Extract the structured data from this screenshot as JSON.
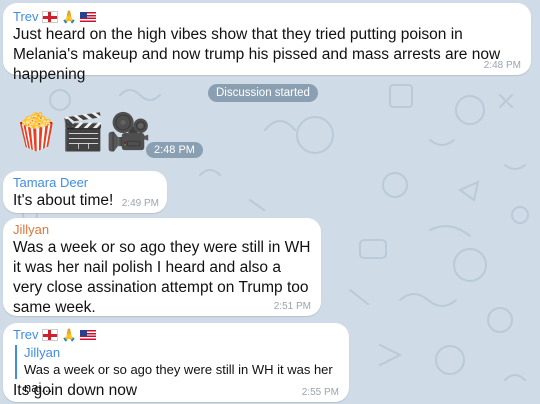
{
  "messages": [
    {
      "sender": "Trev",
      "sender_color": "#3f8ee0",
      "text": "Just heard on the high vibes show that they tried putting poison in Melania's makeup and now trump his pissed and mass arrests are now happening",
      "time": "2:48 PM"
    },
    {
      "divider": "Discussion started",
      "emojis": [
        "popcorn-icon",
        "clapperboard-icon",
        "movie-camera-icon"
      ],
      "time": "2:48 PM"
    },
    {
      "sender": "Tamara Deer",
      "sender_color": "#3f8ee0",
      "text": "It's about time!",
      "time": "2:49 PM"
    },
    {
      "sender": "Jillyan",
      "sender_color": "#d9773e",
      "text": "Was a week or so ago they were still in WH it was her nail polish  I heard and also a very close assination attempt on Trump too same week.",
      "time": "2:51 PM"
    },
    {
      "sender": "Trev",
      "sender_color": "#3f8ee0",
      "reply_to_name": "Jillyan",
      "reply_to_text": "Was a week or so ago they were still in WH it was her nai...",
      "text": "Its goin down now",
      "time": "2:55 PM"
    }
  ]
}
